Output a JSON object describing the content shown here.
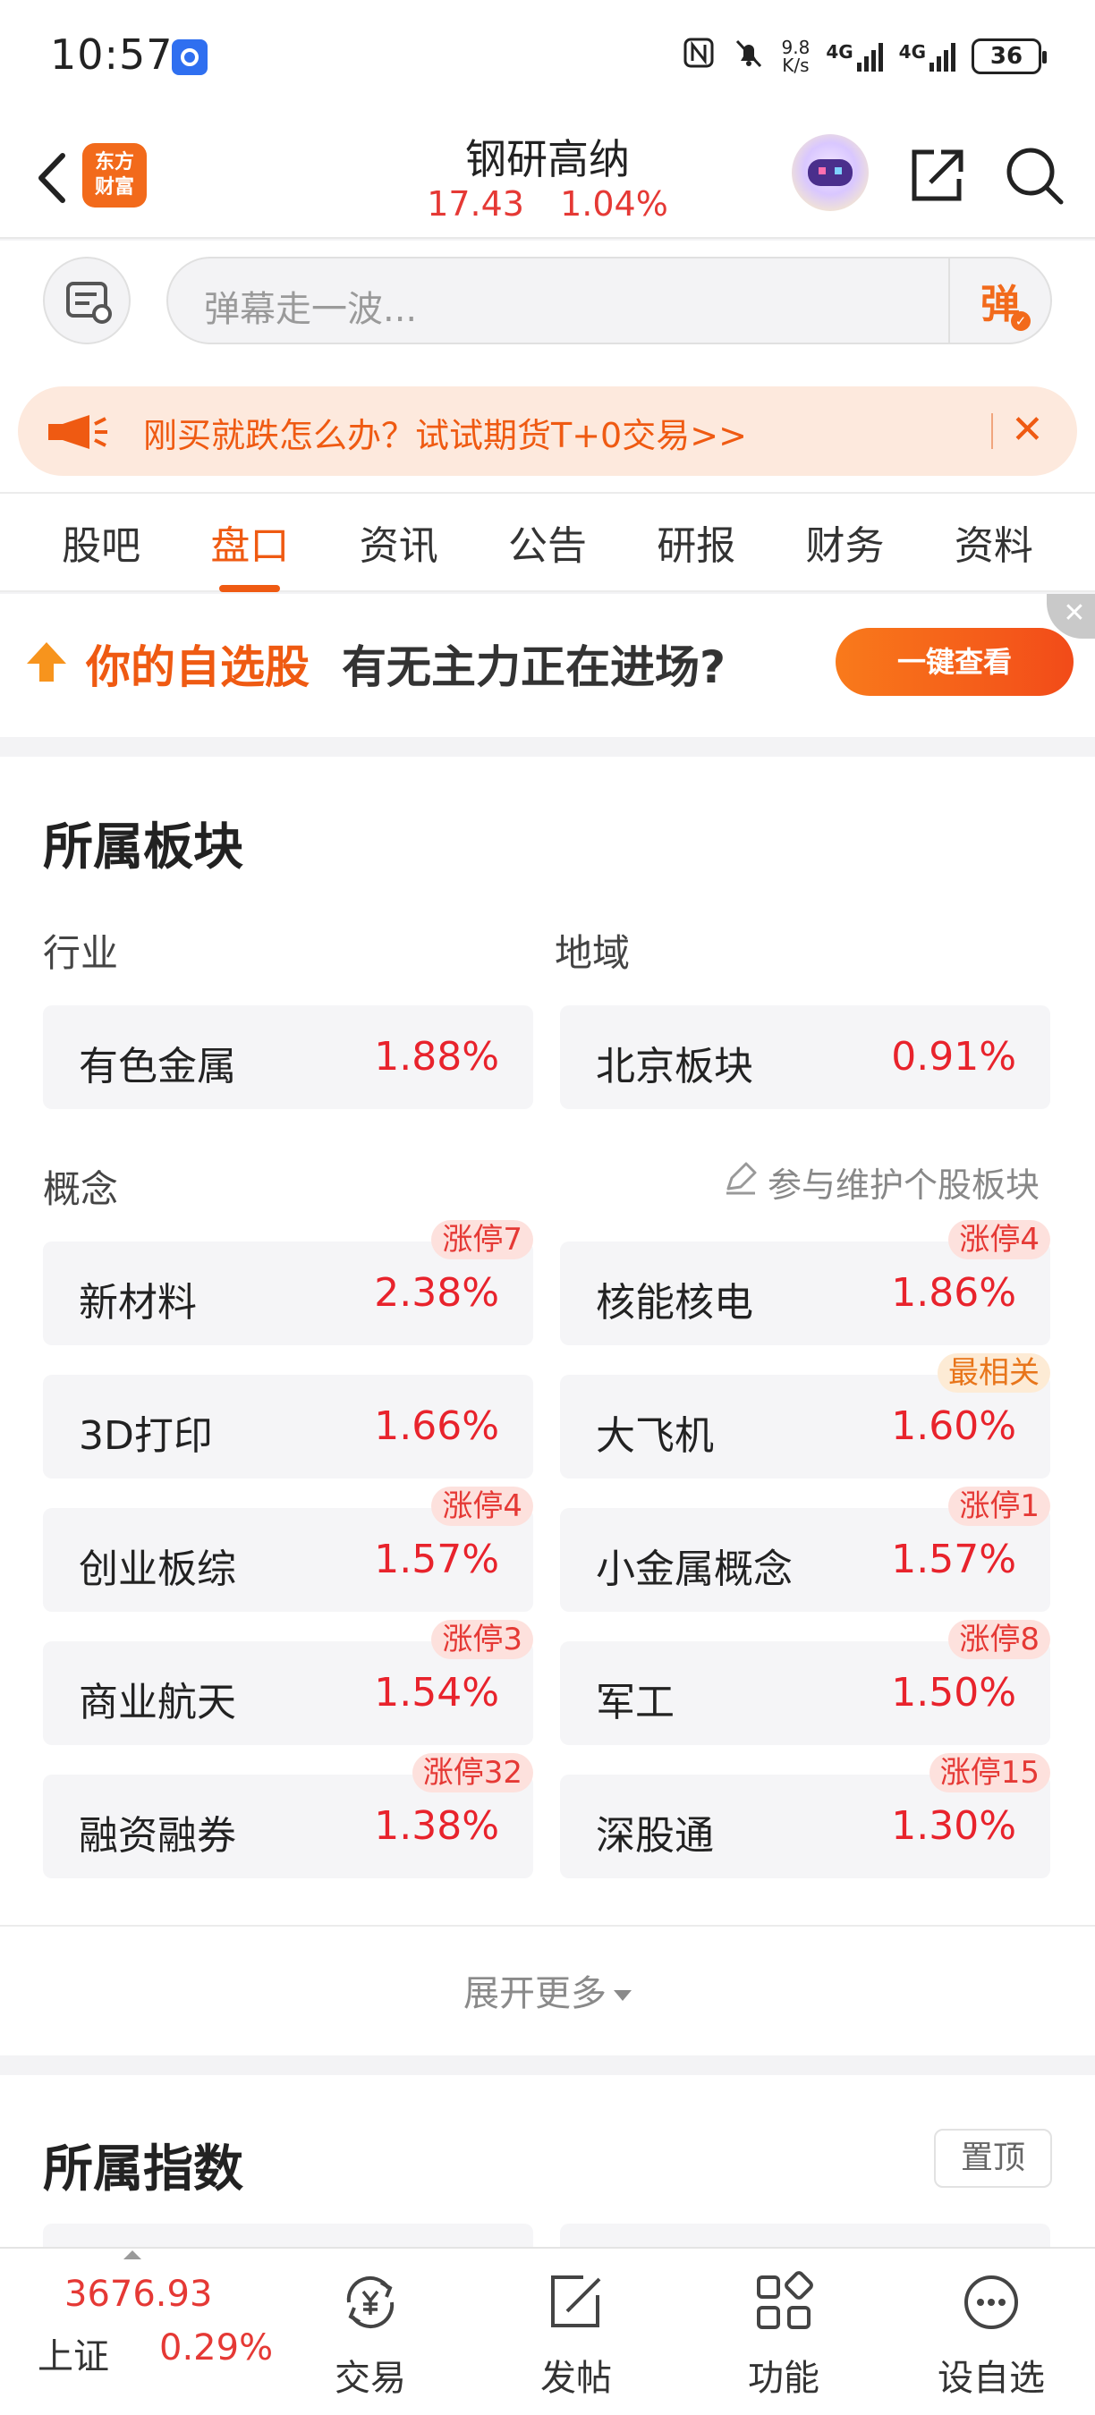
{
  "status_bar": {
    "time": "10:57",
    "speed_value": "9.8",
    "speed_unit": "K/s",
    "net1": "4G",
    "net2": "4G",
    "battery": "36"
  },
  "header": {
    "logo_line1": "东方",
    "logo_line2": "财富",
    "title": "钢研高纳",
    "price": "17.43",
    "change_pct": "1.04%"
  },
  "danmu": {
    "placeholder": "弹幕走一波...",
    "send_label": "弹"
  },
  "promo": {
    "text": "刚买就跌怎么办？试试期货T+0交易>>"
  },
  "tabs": [
    {
      "label": "股吧",
      "active": false
    },
    {
      "label": "盘口",
      "active": true
    },
    {
      "label": "资讯",
      "active": false
    },
    {
      "label": "公告",
      "active": false
    },
    {
      "label": "研报",
      "active": false
    },
    {
      "label": "财务",
      "active": false
    },
    {
      "label": "资料",
      "active": false
    }
  ],
  "ad": {
    "title": "你的自选股",
    "subtitle": "有无主力正在进场?",
    "button": "一键查看"
  },
  "sectors": {
    "title": "所属板块",
    "industry_label": "行业",
    "region_label": "地域",
    "concept_label": "概念",
    "maintain_link": "参与维护个股板块",
    "industry": {
      "name": "有色金属",
      "pct": "1.88%"
    },
    "region": {
      "name": "北京板块",
      "pct": "0.91%"
    },
    "concepts": [
      {
        "name": "新材料",
        "pct": "2.38%",
        "badge": "涨停7"
      },
      {
        "name": "核能核电",
        "pct": "1.86%",
        "badge": "涨停4"
      },
      {
        "name": "3D打印",
        "pct": "1.66%",
        "badge": ""
      },
      {
        "name": "大飞机",
        "pct": "1.60%",
        "badge": "最相关"
      },
      {
        "name": "创业板综",
        "pct": "1.57%",
        "badge": "涨停4"
      },
      {
        "name": "小金属概念",
        "pct": "1.57%",
        "badge": "涨停1"
      },
      {
        "name": "商业航天",
        "pct": "1.54%",
        "badge": "涨停3"
      },
      {
        "name": "军工",
        "pct": "1.50%",
        "badge": "涨停8"
      },
      {
        "name": "融资融券",
        "pct": "1.38%",
        "badge": "涨停32"
      },
      {
        "name": "深股通",
        "pct": "1.30%",
        "badge": "涨停15"
      }
    ],
    "expand_more": "展开更多"
  },
  "indices_section": {
    "title": "所属指数",
    "pin_button": "置顶"
  },
  "bottom_bar": {
    "index_value": "3676.93",
    "index_name": "上证",
    "index_pct": "0.29%",
    "nav": [
      {
        "label": "交易",
        "icon": "trade-yen-icon"
      },
      {
        "label": "发帖",
        "icon": "post-edit-icon"
      },
      {
        "label": "功能",
        "icon": "function-grid-icon"
      },
      {
        "label": "设自选",
        "icon": "add-watchlist-icon"
      }
    ]
  }
}
